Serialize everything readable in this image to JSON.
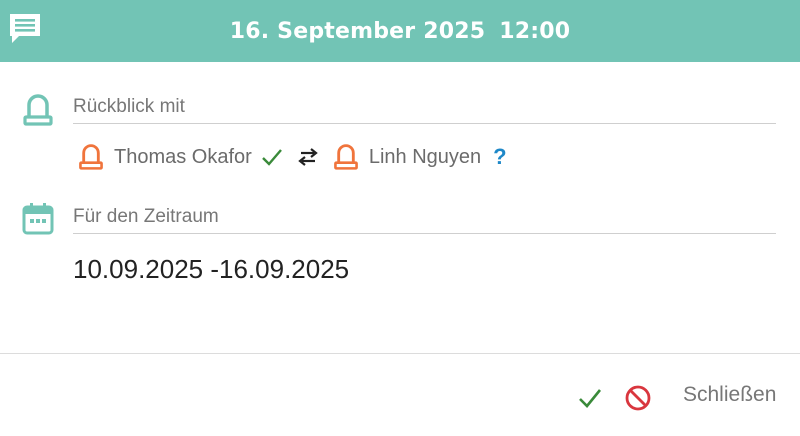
{
  "header": {
    "icon": "chat-message-icon",
    "date": "16. September 2025",
    "time": "12:00",
    "background_color": "#72c4b5"
  },
  "review": {
    "icon": "person-icon",
    "label": "Rückblick mit",
    "participants": [
      {
        "name": "Thomas Okafor",
        "status": "confirmed",
        "status_icon": "checkmark-icon"
      },
      {
        "name": "Linh Nguyen",
        "status": "unknown",
        "status_text": "?"
      }
    ],
    "swap_icon": "swap-arrows-icon"
  },
  "period": {
    "icon": "calendar-icon",
    "label": "Für den Zeitraum",
    "value": "10.09.2025 -16.09.2025"
  },
  "footer": {
    "confirm_icon": "checkmark-icon",
    "cancel_icon": "prohibited-icon",
    "close_label": "Schließen"
  },
  "colors": {
    "accent": "#72c4b5",
    "person": "#f0743c",
    "confirm": "#3a8a3a",
    "cancel": "#d9363e",
    "unknown": "#1e88c8"
  }
}
